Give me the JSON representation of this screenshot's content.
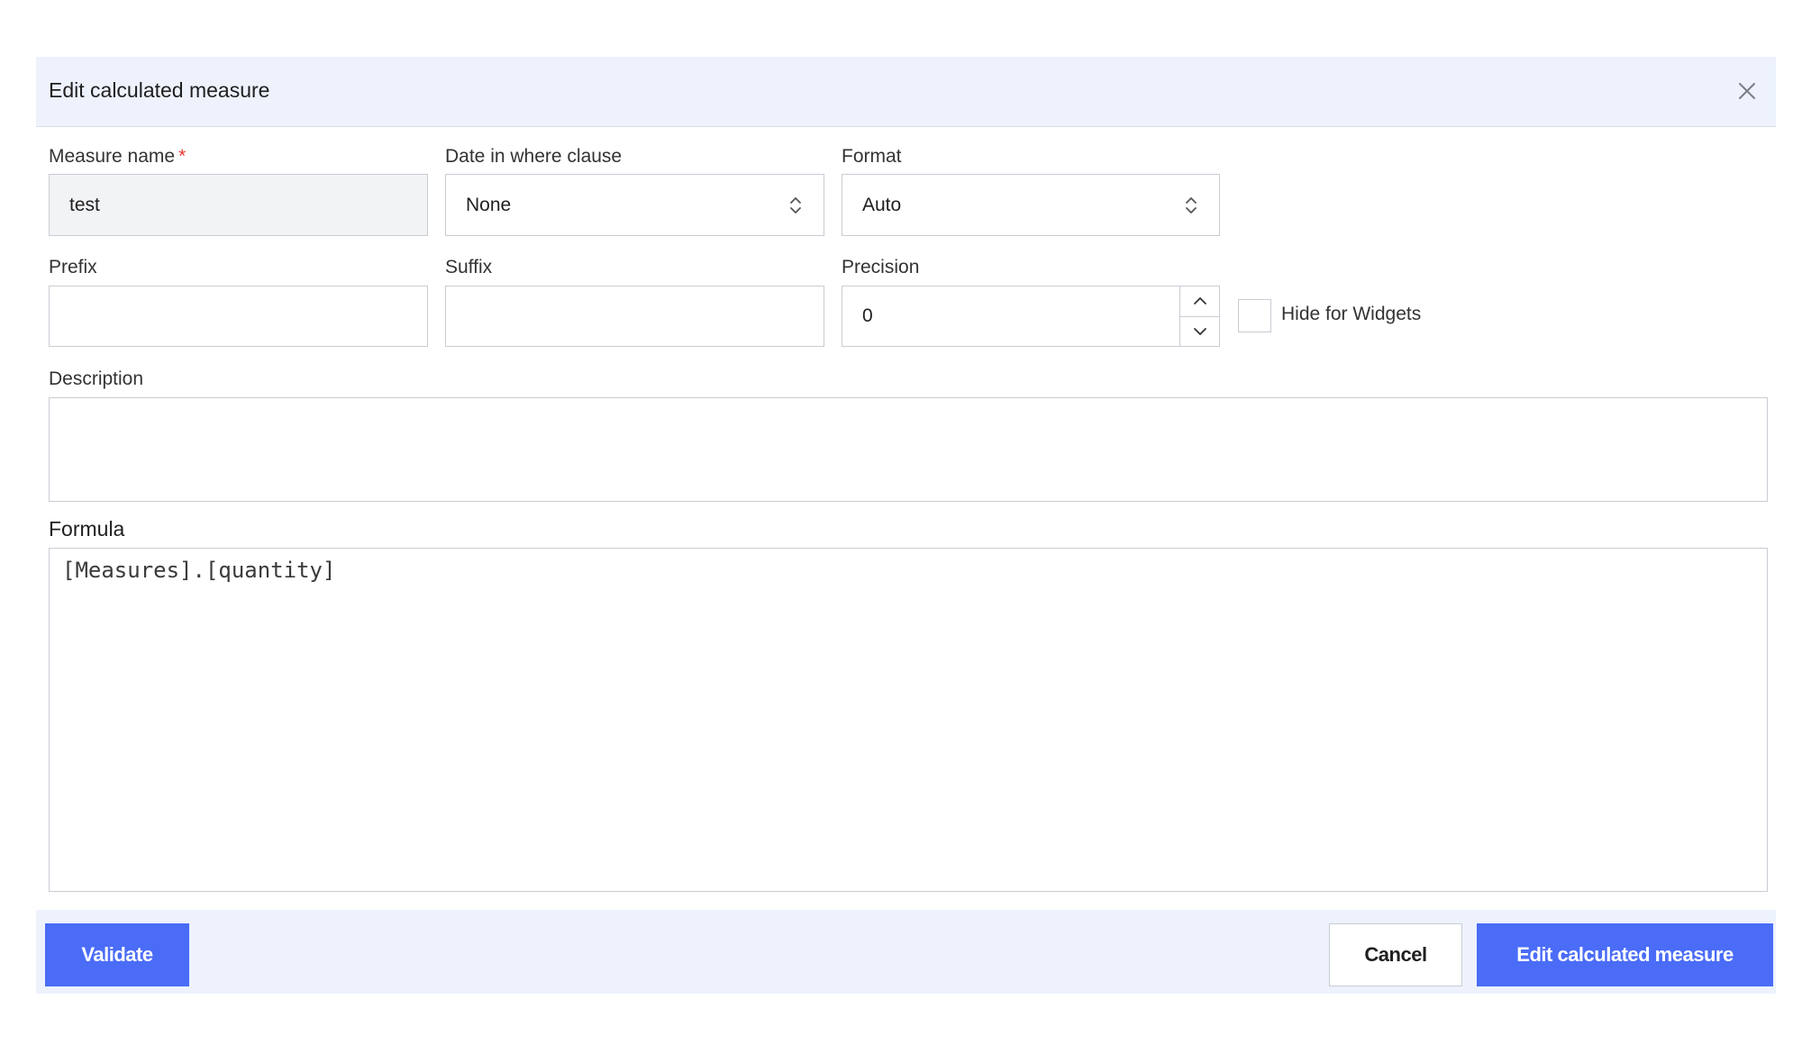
{
  "dialog": {
    "title": "Edit calculated measure",
    "close_icon": "close-icon"
  },
  "fields": {
    "measure_name": {
      "label": "Measure name",
      "required_marker": "*",
      "value": "test"
    },
    "date_in_where_clause": {
      "label": "Date in where clause",
      "selected": "None"
    },
    "format": {
      "label": "Format",
      "selected": "Auto"
    },
    "prefix": {
      "label": "Prefix",
      "value": ""
    },
    "suffix": {
      "label": "Suffix",
      "value": ""
    },
    "precision": {
      "label": "Precision",
      "value": "0"
    },
    "hide_for_widgets": {
      "label": "Hide for Widgets",
      "checked": false
    },
    "description": {
      "label": "Description",
      "value": ""
    },
    "formula": {
      "label": "Formula",
      "value": "[Measures].[quantity]"
    }
  },
  "footer": {
    "validate_label": "Validate",
    "cancel_label": "Cancel",
    "submit_label": "Edit calculated measure"
  },
  "colors": {
    "accent": "#4a6cf7",
    "header_bg": "#edf2fd",
    "required": "#e53935",
    "border": "#c9ccd3"
  }
}
